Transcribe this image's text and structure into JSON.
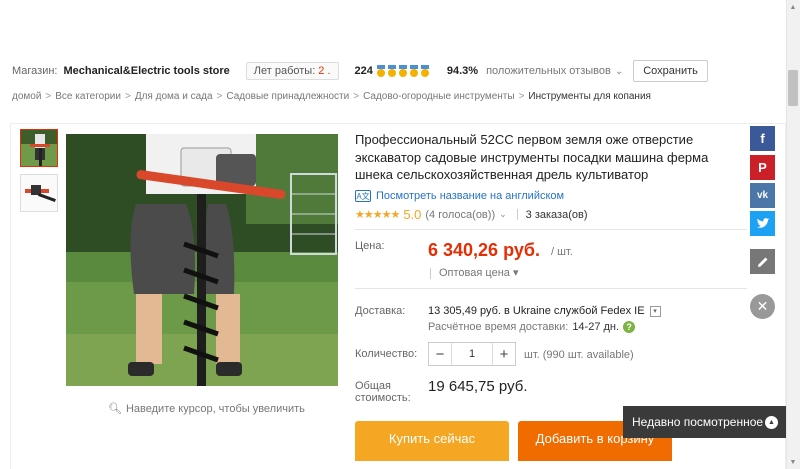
{
  "store": {
    "label": "Магазин:",
    "name": "Mechanical&Electric tools store",
    "years_label": "Лет работы:",
    "years_value": "2 .",
    "feedback_count": "224",
    "positive_pct": "94.3%",
    "positive_label": "положительных отзывов",
    "save_label": "Сохранить"
  },
  "breadcrumb": [
    "домой",
    "Все категории",
    "Для дома и сада",
    "Садовые принадлежности",
    "Садово-огородные инструменты",
    "Инструменты для копания"
  ],
  "product": {
    "title": "Профессиональный 52CC первом земля оже отверстие экскаватор садовые инструменты посадки машина ферма шнека сельскохозяйственная дрель культиватор",
    "translate_link": "Посмотреть название на английском",
    "stars": "★★★★★",
    "rating": "5.0",
    "votes": "(4 голоса(ов))",
    "orders": "3 заказа(ов)"
  },
  "price": {
    "label": "Цена:",
    "value": "6 340,26 руб.",
    "unit": "/ шт.",
    "wholesale": "Оптовая цена ▾"
  },
  "shipping": {
    "label": "Доставка:",
    "value": "13 305,49 руб. в Ukraine службой Fedex IE",
    "eta_label": "Расчётное время доставки:",
    "eta_value": "14-27 дн."
  },
  "quantity": {
    "label": "Количество:",
    "value": "1",
    "available": "шт. (990 шт. available)"
  },
  "total": {
    "label": "Общая стоимость:",
    "value": "19 645,75 руб."
  },
  "buttons": {
    "buy_now": "Купить сейчас",
    "add_to_cart": "Добавить в корзину"
  },
  "zoom_hint": "Наведите курсор, чтобы увеличить",
  "recently_viewed": "Недавно посмотренное",
  "social": [
    "facebook-icon",
    "pinterest-icon",
    "vk-icon",
    "twitter-icon",
    "pencil-icon"
  ],
  "colors": {
    "accent": "#e62e04",
    "buy": "#f5a623",
    "cart": "#f06c00",
    "link": "#2673c7"
  }
}
